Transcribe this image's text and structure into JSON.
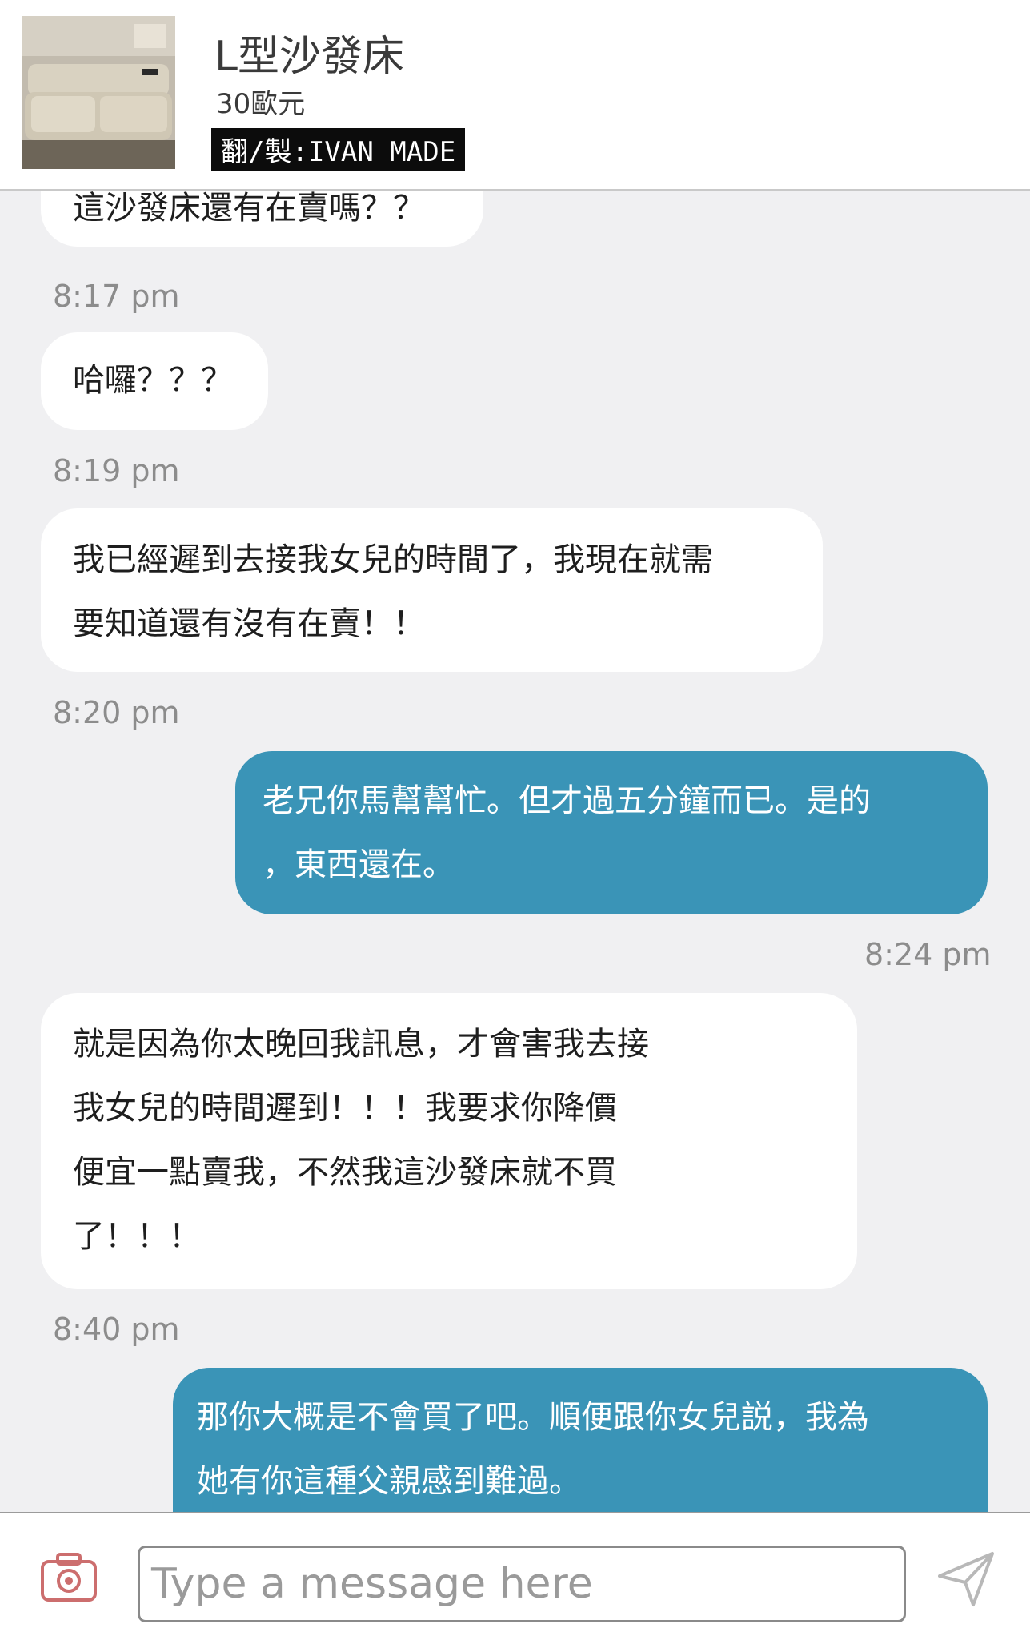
{
  "listing": {
    "title": "L型沙發床",
    "price": "30歐元",
    "credit": "翻/製:IVAN MADE"
  },
  "messages": [
    {
      "dir": "in",
      "lines": [
        "這沙發床還有在賣嗎？？"
      ],
      "time": "8:17 pm"
    },
    {
      "dir": "in",
      "lines": [
        "哈囉？？？"
      ],
      "time": "8:19 pm"
    },
    {
      "dir": "in",
      "lines": [
        "我已經遲到去接我女兒的時間了，我現在就需",
        "要知道還有沒有在賣！！"
      ],
      "time": "8:20 pm"
    },
    {
      "dir": "out",
      "lines": [
        "老兄你馬幫幫忙。但才過五分鐘而已。是的",
        "，東西還在。"
      ],
      "time": "8:24 pm"
    },
    {
      "dir": "in",
      "lines": [
        "就是因為你太晚回我訊息，才會害我去接",
        "我女兒的時間遲到！！！我要求你降價",
        "便宜一點賣我，不然我這沙發床就不買",
        "了！！！"
      ],
      "time": "8:40 pm"
    },
    {
      "dir": "out",
      "lines": [
        "那你大概是不會買了吧。順便跟你女兒説，我為",
        "她有你這種父親感到難過。"
      ],
      "time": ""
    }
  ],
  "composer": {
    "placeholder": "Type a message here"
  },
  "colors": {
    "outgoing_bubble": "#3a94b7",
    "incoming_bubble": "#ffffff",
    "background": "#f0f0f2"
  }
}
